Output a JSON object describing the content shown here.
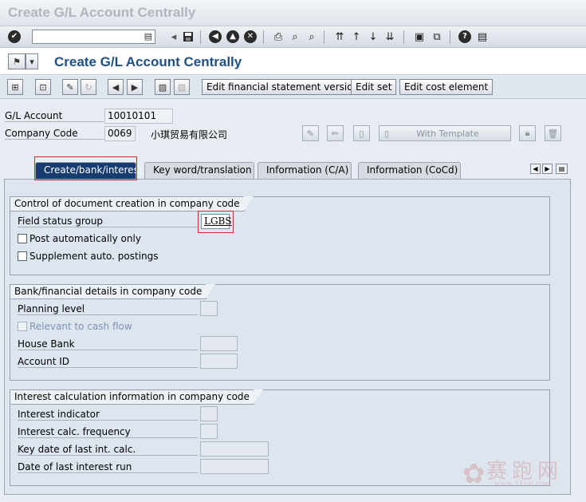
{
  "window": {
    "title": "Create G/L Account Centrally"
  },
  "app": {
    "title": "Create G/L Account Centrally"
  },
  "app_toolbar": {
    "buttons": [
      "Edit financial statement version",
      "Edit set",
      "Edit cost element"
    ]
  },
  "header": {
    "gl_account_label": "G/L Account",
    "gl_account_value": "10010101",
    "company_code_label": "Company Code",
    "company_code_value": "0069",
    "company_name": "小琪贸易有限公司",
    "with_template_label": "With Template"
  },
  "tabs": [
    {
      "label": "Create/bank/interest",
      "active": true
    },
    {
      "label": "Key word/translation",
      "active": false
    },
    {
      "label": "Information (C/A)",
      "active": false
    },
    {
      "label": "Information (CoCd)",
      "active": false
    }
  ],
  "group_doc_creation": {
    "title": "Control of document creation in company code",
    "field_status_group_label": "Field status group",
    "field_status_group_value": "LGBS",
    "post_auto_label": "Post automatically only",
    "post_auto_checked": false,
    "supplement_label": "Supplement auto. postings",
    "supplement_checked": false
  },
  "group_bank": {
    "title": "Bank/financial details in company code",
    "planning_level_label": "Planning level",
    "planning_level_value": "",
    "cash_flow_label": "Relevant to cash flow",
    "cash_flow_checked": false,
    "house_bank_label": "House Bank",
    "house_bank_value": "",
    "account_id_label": "Account ID",
    "account_id_value": ""
  },
  "group_interest": {
    "title": "Interest calculation information in company code",
    "indicator_label": "Interest indicator",
    "indicator_value": "",
    "frequency_label": "Interest calc. frequency",
    "frequency_value": "",
    "key_date_label": "Key date of last int. calc.",
    "key_date_value": "",
    "last_run_label": "Date of last interest run",
    "last_run_value": ""
  },
  "watermark": {
    "text": "赛跑网",
    "url": "www.51sai.com"
  },
  "icons": {
    "standard_toolbar": [
      "enter-icon",
      "save-icon",
      "back-icon",
      "exit-icon",
      "cancel-icon",
      "print-icon",
      "find-icon",
      "find-next-icon",
      "first-page-icon",
      "previous-page-icon",
      "next-page-icon",
      "last-page-icon",
      "create-session-icon",
      "shortcut-icon",
      "help-icon",
      "customize-layout-icon"
    ]
  },
  "colors": {
    "active_tab": "#173c70",
    "title_blue": "#1f4f8a",
    "highlight_red": "#d12b2b"
  }
}
